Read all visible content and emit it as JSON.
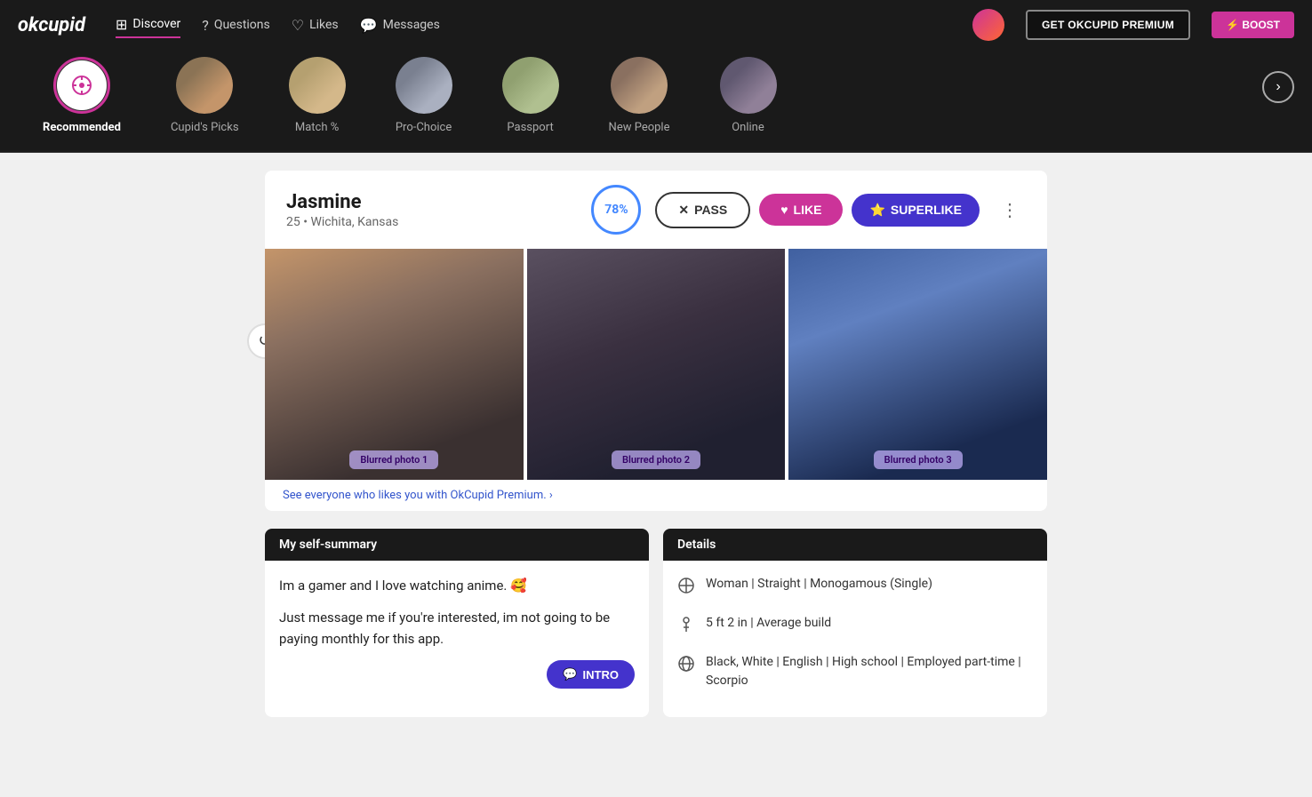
{
  "logo": "okcupid",
  "nav": {
    "items": [
      {
        "id": "discover",
        "label": "Discover",
        "icon": "⊞",
        "active": true
      },
      {
        "id": "questions",
        "label": "Questions",
        "icon": "❓"
      },
      {
        "id": "likes",
        "label": "Likes",
        "icon": "♡"
      },
      {
        "id": "messages",
        "label": "Messages",
        "icon": "💬"
      }
    ],
    "premium_btn": "GET OKCUPID PREMIUM",
    "boost_btn": "⚡ BOOST"
  },
  "categories": [
    {
      "id": "recommended",
      "label": "Recommended",
      "type": "icon",
      "active": true
    },
    {
      "id": "cupids-picks",
      "label": "Cupid's Picks",
      "type": "photo",
      "photo_class": "cat-photo-1"
    },
    {
      "id": "match",
      "label": "Match %",
      "type": "photo",
      "photo_class": "cat-photo-2"
    },
    {
      "id": "pro-choice",
      "label": "Pro-Choice",
      "type": "photo",
      "photo_class": "cat-photo-3"
    },
    {
      "id": "passport",
      "label": "Passport",
      "type": "photo",
      "photo_class": "cat-photo-4"
    },
    {
      "id": "new-people",
      "label": "New People",
      "type": "photo",
      "photo_class": "cat-photo-5"
    },
    {
      "id": "online",
      "label": "Online",
      "type": "photo",
      "photo_class": "cat-photo-6"
    }
  ],
  "profile": {
    "name": "Jasmine",
    "age": "25",
    "location": "Wichita, Kansas",
    "match_pct": "78%",
    "pass_label": "PASS",
    "like_label": "LIKE",
    "superlike_label": "SUPERLIKE",
    "premium_promo": "See everyone who likes you with OkCupid Premium. ›",
    "photos": [
      {
        "label": "Blurred photo 1"
      },
      {
        "label": "Blurred photo 2"
      },
      {
        "label": "Blurred photo 3"
      }
    ]
  },
  "self_summary": {
    "header": "My self-summary",
    "text1": "Im a gamer and I love watching anime. 🥰",
    "text2": "Just message me if you're interested, im not going to be paying monthly for this app.",
    "intro_label": "INTRO"
  },
  "details": {
    "header": "Details",
    "rows": [
      {
        "icon": "👤",
        "text": "Woman | Straight | Monogamous (Single)"
      },
      {
        "icon": "📏",
        "text": "5 ft 2 in | Average build"
      },
      {
        "icon": "🌐",
        "text": "Black, White | English | High school | Employed part-time | Scorpio"
      }
    ]
  }
}
